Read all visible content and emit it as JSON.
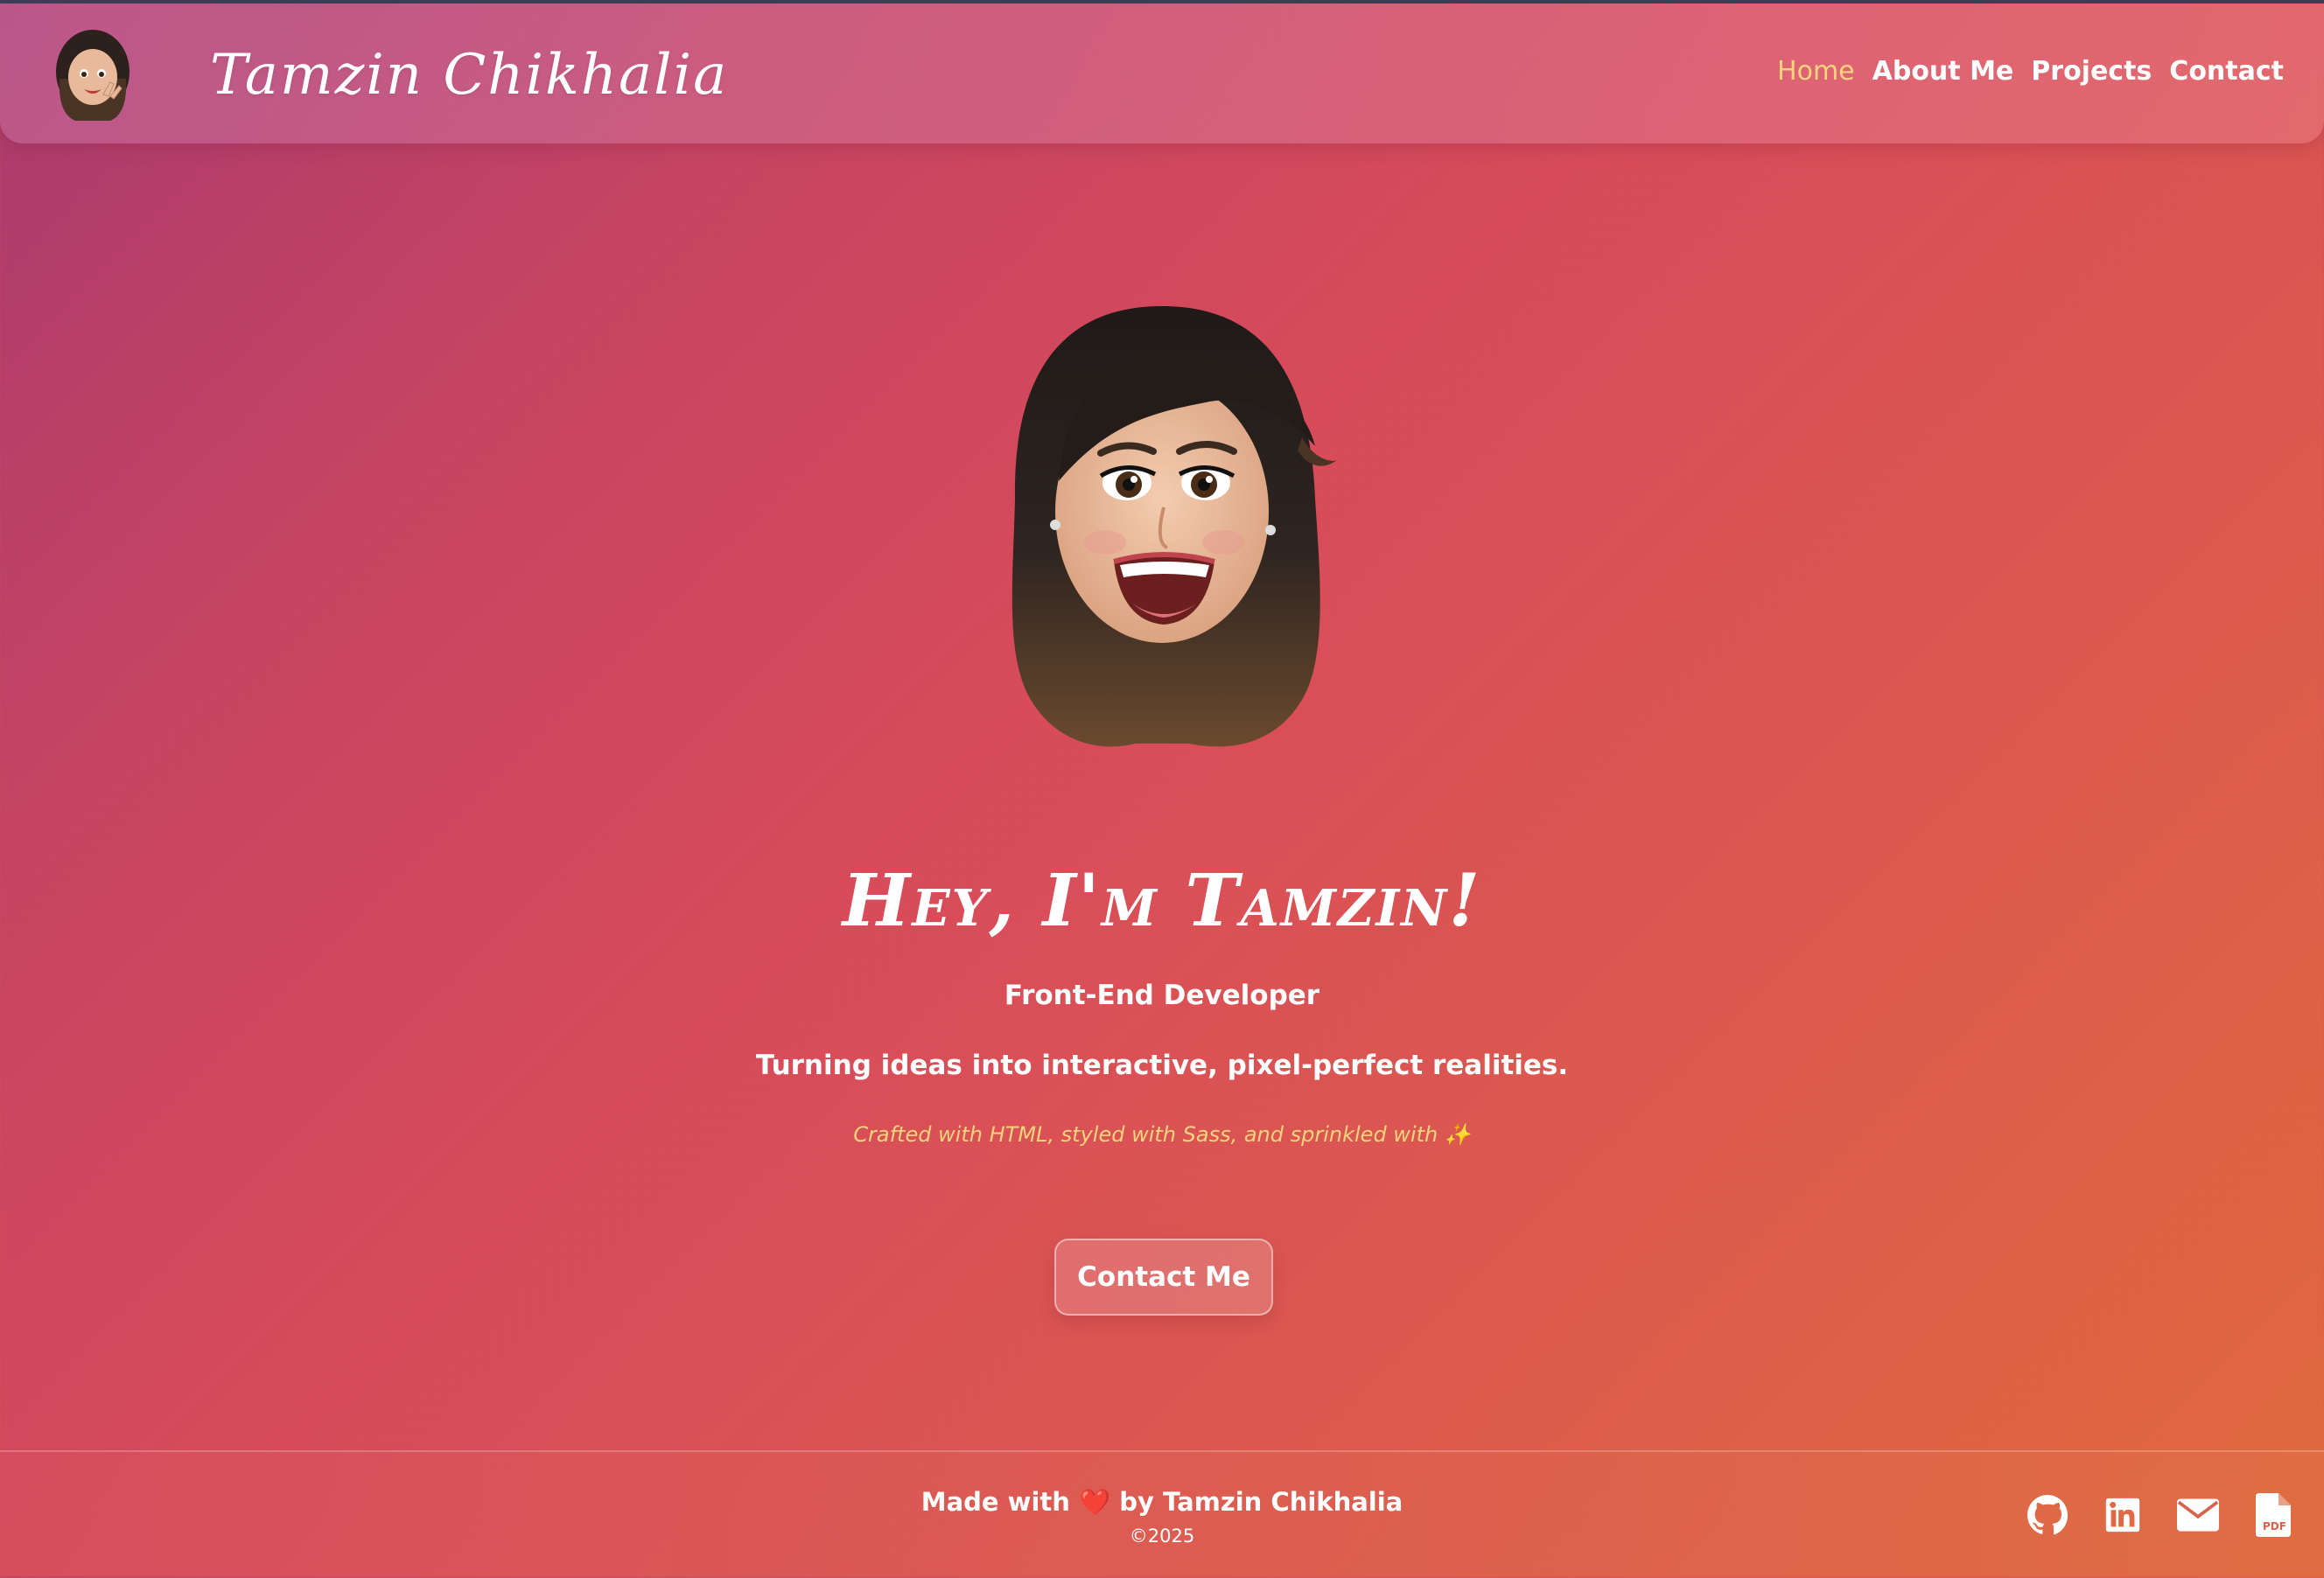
{
  "brand": {
    "name": "Tamzin Chikhalia"
  },
  "nav": {
    "items": [
      {
        "label": "Home",
        "active": true
      },
      {
        "label": "About Me",
        "active": false
      },
      {
        "label": "Projects",
        "active": false
      },
      {
        "label": "Contact",
        "active": false
      }
    ]
  },
  "hero": {
    "title": "Hey, I'm Tamzin!",
    "role": "Front-End Developer",
    "tagline": "Turning ideas into interactive, pixel-perfect realities.",
    "crafted": "Crafted with HTML, styled with Sass, and sprinkled with ✨",
    "cta_label": "Contact Me"
  },
  "footer": {
    "made_prefix": "Made with",
    "heart": "❤️",
    "made_suffix": "by Tamzin Chikhalia",
    "copyright": "©2025",
    "icons": [
      "github-icon",
      "linkedin-icon",
      "mail-icon",
      "pdf-icon"
    ]
  },
  "colors": {
    "accent": "#f7d37e",
    "gradient_start": "#a93a6e",
    "gradient_end": "#e06a3c"
  }
}
